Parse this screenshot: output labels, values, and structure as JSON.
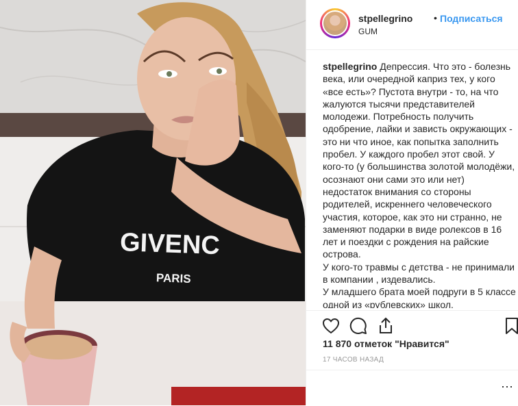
{
  "post": {
    "photo_alt": "",
    "shirt_text_line1": "GIVENC",
    "shirt_text_line2": "PARIS"
  },
  "header": {
    "username": "stpellegrino",
    "separator": "•",
    "follow_label": "Подписаться",
    "location": "GUM"
  },
  "caption": {
    "username": "stpellegrino",
    "paragraphs": [
      "Депрессия. Что это - болезнь века, или очередной каприз тех, у кого «все есть»? Пустота внутри - то, на что жалуются тысячи представителей молодежи. Потребность получить одобрение, лайки и зависть окружающих - это ни что иное, как попытка заполнить пробел. У каждого пробел этот свой. У кого-то (у большинства золотой молодёжи, осознают они сами это или нет) недостаток внимания со стороны родителей, искреннего человеческого участия, которое, как это ни странно, не заменяют подарки в виде ролексов в 16 лет и поездки с рождения на райские острова.",
      "У кого-то травмы с детства - не принимали в компании , издевались.",
      "У младшего брата моей подруги в 5 классе одной из «рублевских» школ,"
    ]
  },
  "actions": {
    "like_icon": "heart-icon",
    "comment_icon": "comment-icon",
    "share_icon": "share-icon",
    "save_icon": "bookmark-icon"
  },
  "likes_text": "11 870 отметок \"Нравится\"",
  "timestamp": "17 ЧАСОВ НАЗАД",
  "comment": {
    "placeholder": "",
    "more_icon": "more-icon"
  },
  "colors": {
    "follow_blue": "#3897f0",
    "border": "#efefef",
    "text": "#262626",
    "muted": "#999999"
  }
}
